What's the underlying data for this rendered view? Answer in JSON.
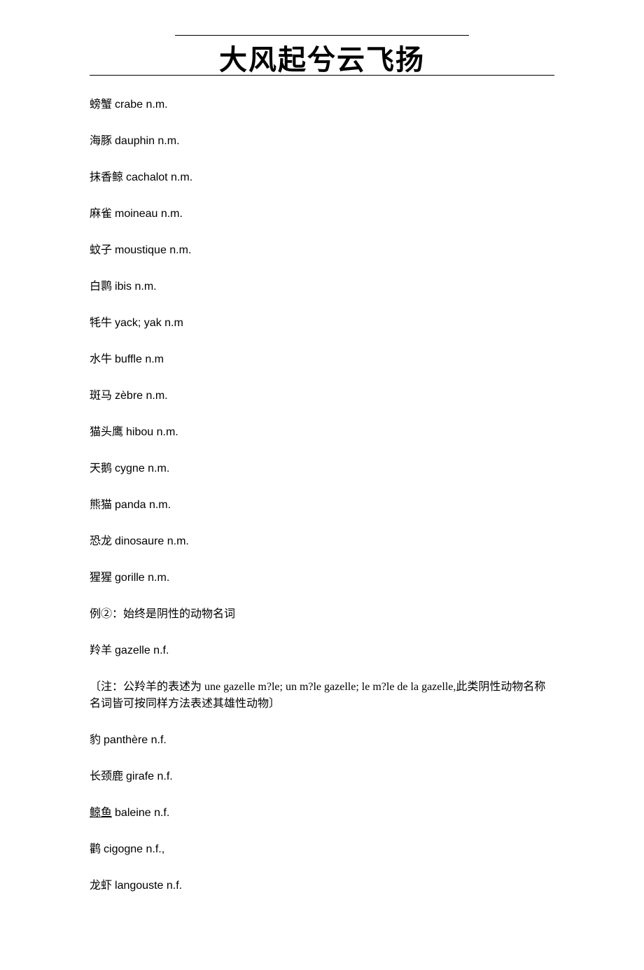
{
  "header": {
    "title": "大风起兮云飞扬"
  },
  "entries": [
    {
      "cn": "螃蟹",
      "fr": "crabe n.m."
    },
    {
      "cn": "海豚",
      "fr": "dauphin n.m."
    },
    {
      "cn": "抹香鲸",
      "fr": "cachalot n.m."
    },
    {
      "cn": "麻雀",
      "fr": "moineau n.m."
    },
    {
      "cn": "蚊子",
      "fr": "moustique n.m."
    },
    {
      "cn": "白鹮",
      "fr": "ibis n.m."
    },
    {
      "cn": "牦牛",
      "fr": "yack; yak n.m"
    },
    {
      "cn": "水牛",
      "fr": "buffle n.m"
    },
    {
      "cn": "斑马",
      "fr": "zèbre n.m."
    },
    {
      "cn": "猫头鹰",
      "fr": "hibou n.m."
    },
    {
      "cn": "天鹅",
      "fr": "cygne n.m."
    },
    {
      "cn": "熊猫",
      "fr": "panda n.m."
    },
    {
      "cn": "恐龙",
      "fr": "dinosaure n.m."
    },
    {
      "cn": "猩猩",
      "fr": "gorille n.m."
    }
  ],
  "section2_heading": "例②：始终是阴性的动物名词",
  "entries2_first": {
    "cn": "羚羊",
    "fr": "gazelle n.f."
  },
  "note": "〔注：公羚羊的表述为 une gazelle m?le; un m?le gazelle; le m?le de la gazelle,此类阴性动物名称名词皆可按同样方法表述其雄性动物〕",
  "entries2_rest": [
    {
      "cn": "豹",
      "fr": "panthère n.f."
    },
    {
      "cn": "长颈鹿",
      "fr": "girafe n.f."
    },
    {
      "cn": "鲸鱼",
      "fr": "baleine n.f.",
      "underline_cn": true
    },
    {
      "cn": "鹳",
      "fr": "cigogne n.f.,"
    },
    {
      "cn": "龙虾",
      "fr": "langouste n.f."
    }
  ]
}
